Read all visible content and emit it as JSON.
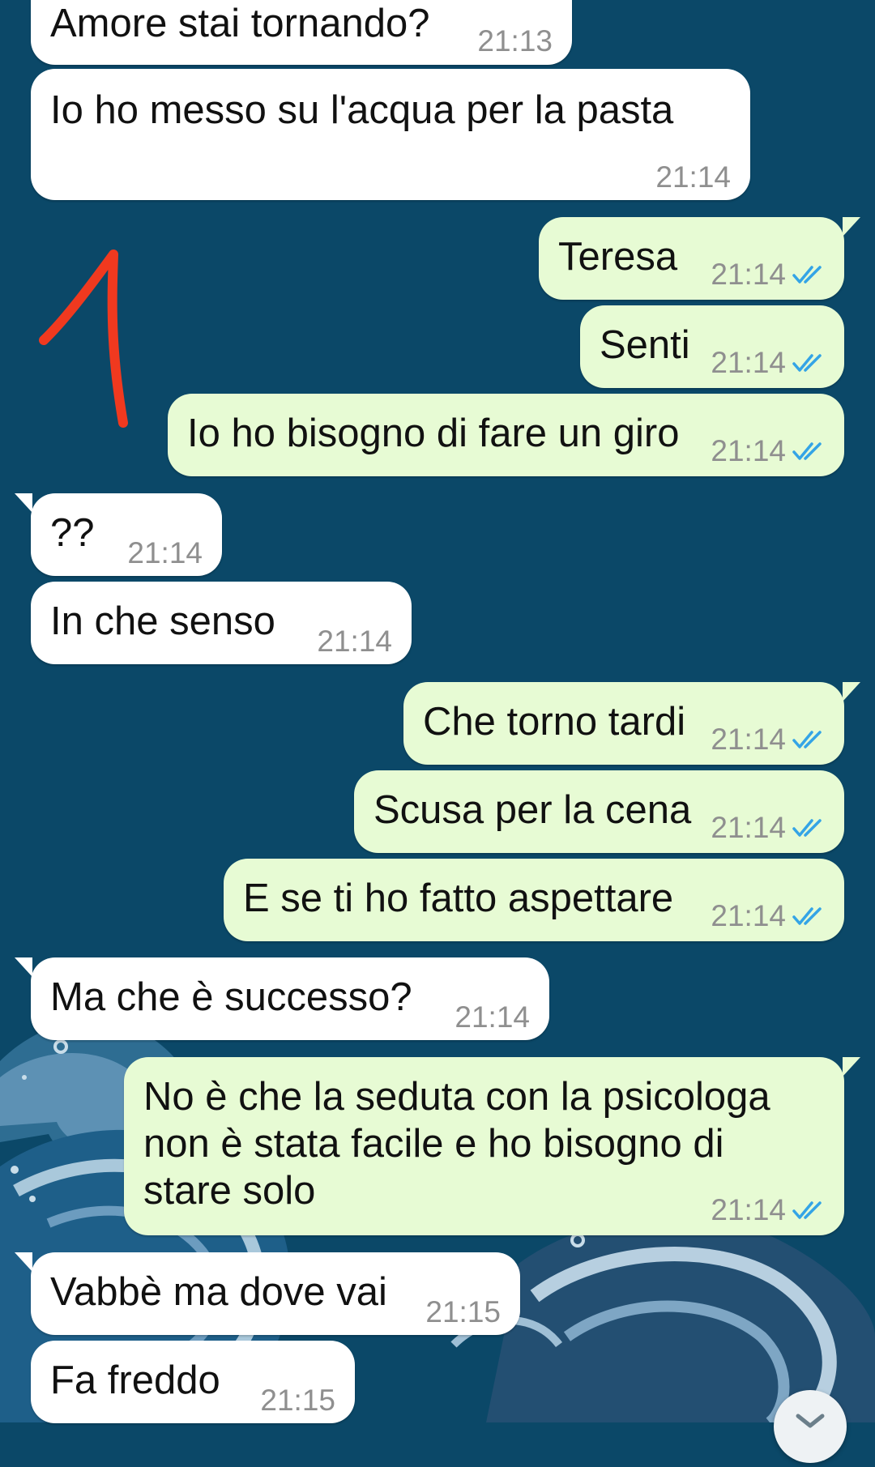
{
  "messages": [
    {
      "direction": "in",
      "text": "Amore stai tornando?",
      "time": "21:13"
    },
    {
      "direction": "in",
      "text": "Io ho messo su l'acqua per la pasta",
      "time": "21:14"
    },
    {
      "direction": "out",
      "text": "Teresa",
      "time": "21:14",
      "status": "read"
    },
    {
      "direction": "out",
      "text": "Senti",
      "time": "21:14",
      "status": "read"
    },
    {
      "direction": "out",
      "text": "Io ho bisogno di fare un giro",
      "time": "21:14",
      "status": "read"
    },
    {
      "direction": "in",
      "text": "??",
      "time": "21:14"
    },
    {
      "direction": "in",
      "text": "In che senso",
      "time": "21:14"
    },
    {
      "direction": "out",
      "text": "Che torno tardi",
      "time": "21:14",
      "status": "read"
    },
    {
      "direction": "out",
      "text": "Scusa per la cena",
      "time": "21:14",
      "status": "read"
    },
    {
      "direction": "out",
      "text": "E se ti ho fatto aspettare",
      "time": "21:14",
      "status": "read"
    },
    {
      "direction": "in",
      "text": "Ma che è successo?",
      "time": "21:14"
    },
    {
      "direction": "out",
      "text": "No è che la seduta con la psicologa\nnon è stata facile e ho bisogno di\nstare solo",
      "time": "21:14",
      "status": "read"
    },
    {
      "direction": "in",
      "text": "Vabbè ma dove vai",
      "time": "21:15"
    },
    {
      "direction": "in",
      "text": "Fa freddo",
      "time": "21:15"
    }
  ],
  "annotation": {
    "text": "1",
    "color": "#f0391f"
  },
  "colors": {
    "background": "#0b4868",
    "incoming_bubble": "#ffffff",
    "outgoing_bubble": "#e7fbd4",
    "read_ticks": "#34a4e6",
    "timestamp": "#8f8f8f"
  },
  "icons": {
    "read_status": "double-check-icon",
    "scroll_button": "chevron-down-icon"
  }
}
